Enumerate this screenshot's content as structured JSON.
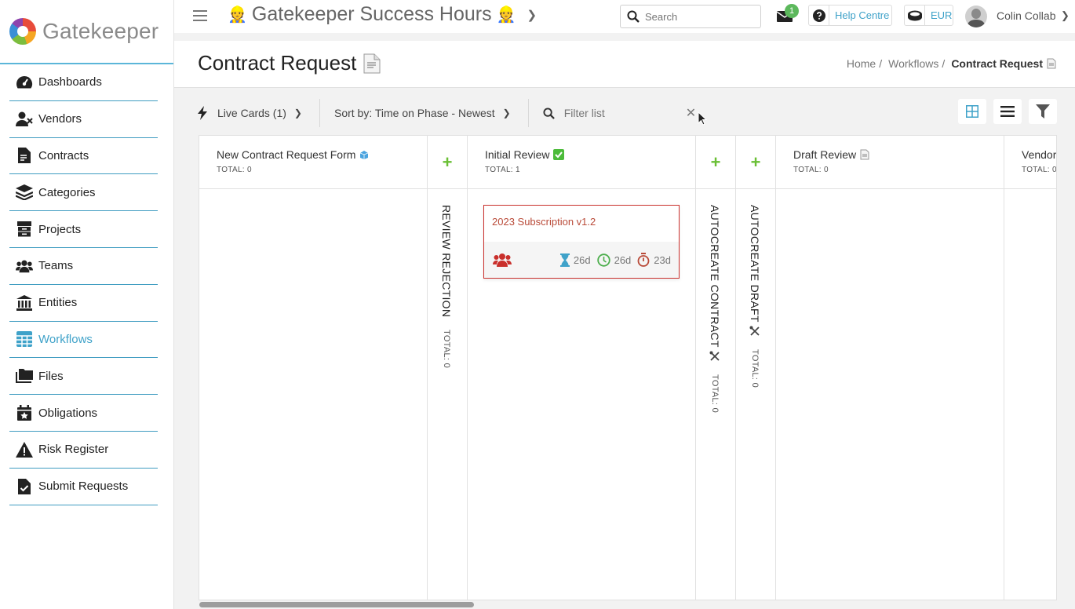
{
  "brand": {
    "name": "Gatekeeper"
  },
  "sidebar": {
    "items": [
      {
        "label": "Dashboards",
        "icon": "dashboard-icon",
        "active": false
      },
      {
        "label": "Vendors",
        "icon": "vendors-icon",
        "active": false
      },
      {
        "label": "Contracts",
        "icon": "contract-icon",
        "active": false
      },
      {
        "label": "Categories",
        "icon": "layers-icon",
        "active": false
      },
      {
        "label": "Projects",
        "icon": "archive-icon",
        "active": false
      },
      {
        "label": "Teams",
        "icon": "users-icon",
        "active": false
      },
      {
        "label": "Entities",
        "icon": "bank-icon",
        "active": false
      },
      {
        "label": "Workflows",
        "icon": "table-icon",
        "active": true
      },
      {
        "label": "Files",
        "icon": "folders-icon",
        "active": false
      },
      {
        "label": "Obligations",
        "icon": "calendar-star-icon",
        "active": false
      },
      {
        "label": "Risk Register",
        "icon": "warning-icon",
        "active": false
      },
      {
        "label": "Submit Requests",
        "icon": "file-check-icon",
        "active": false
      }
    ]
  },
  "topbar": {
    "title": "Gatekeeper Success Hours",
    "title_emoji": "👷",
    "search_placeholder": "Search",
    "notifications_count": "1",
    "help_label": "Help Centre",
    "currency": "EUR",
    "user_name": "Colin Collab"
  },
  "page": {
    "title": "Contract Request",
    "breadcrumb": {
      "home": "Home",
      "workflows": "Workflows",
      "current": "Contract Request"
    }
  },
  "toolbar": {
    "live_cards": "Live Cards (1)",
    "sort": "Sort by: Time on Phase - Newest",
    "filter_placeholder": "Filter list"
  },
  "board": {
    "columns": {
      "new_form": {
        "name": "New Contract Request Form",
        "total": "TOTAL: 0"
      },
      "review_rejection": {
        "name": "REVIEW REJECTION",
        "total": "TOTAL: 0"
      },
      "initial_review": {
        "name": "Initial Review",
        "total": "TOTAL: 1"
      },
      "autocreate_contract": {
        "name": "AUTOCREATE CONTRACT",
        "total": "TOTAL: 0"
      },
      "autocreate_draft": {
        "name": "AUTOCREATE DRAFT",
        "total": "TOTAL: 0"
      },
      "draft_review": {
        "name": "Draft Review",
        "total": "TOTAL: 0"
      },
      "vendor": {
        "name": "Vendor",
        "total": "TOTAL: 0"
      }
    },
    "card": {
      "title": "2023 Subscription v1.2",
      "hourglass": "26d",
      "clock": "26d",
      "stopwatch": "23d"
    }
  },
  "colors": {
    "accent": "#3fa2c9",
    "add": "#6abf35",
    "card_border": "#c9302c"
  }
}
